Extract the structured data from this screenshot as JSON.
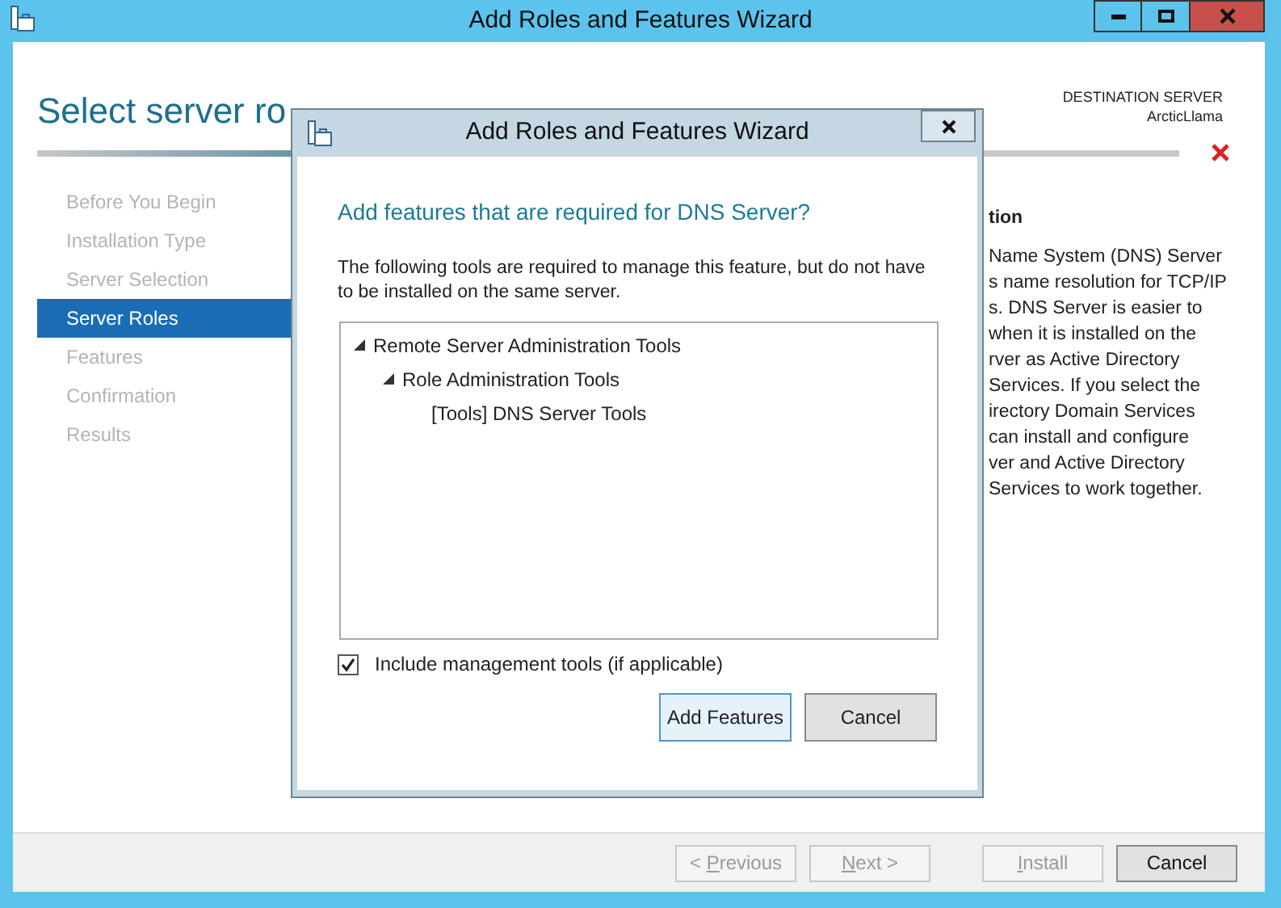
{
  "window": {
    "title": "Add Roles and Features Wizard"
  },
  "page": {
    "title": "Select server ro",
    "destination_label": "DESTINATION SERVER",
    "destination_server": "ArcticLlama"
  },
  "steps": [
    {
      "label": "Before You Begin",
      "selected": false
    },
    {
      "label": "Installation Type",
      "selected": false
    },
    {
      "label": "Server Selection",
      "selected": false
    },
    {
      "label": "Server Roles",
      "selected": true
    },
    {
      "label": "Features",
      "selected": false
    },
    {
      "label": "Confirmation",
      "selected": false
    },
    {
      "label": "Results",
      "selected": false
    }
  ],
  "description": {
    "heading": "tion",
    "lines": [
      "Name System (DNS) Server",
      "s name resolution for TCP/IP",
      "s. DNS Server is easier to",
      "when it is installed on the",
      "rver as Active Directory",
      "Services. If you select the",
      "irectory Domain Services",
      "can install and configure",
      "ver and Active Directory",
      "Services to work together."
    ]
  },
  "dialog": {
    "title": "Add Roles and Features Wizard",
    "heading": "Add features that are required for DNS Server?",
    "text": "The following tools are required to manage this feature, but do not have to be installed on the same server.",
    "tree": [
      {
        "label": "Remote Server Administration Tools",
        "expanded": true,
        "children": [
          {
            "label": "Role Administration Tools",
            "expanded": true,
            "children": [
              {
                "label": "[Tools] DNS Server Tools"
              }
            ]
          }
        ]
      }
    ],
    "include_tools": {
      "label": "Include management tools (if applicable)",
      "checked": true
    },
    "buttons": [
      {
        "label": "Add Features",
        "selected": true
      },
      {
        "label": "Cancel",
        "selected": false
      }
    ]
  },
  "footer_buttons": [
    {
      "before": "< ",
      "key": "P",
      "after": "revious",
      "disabled": true
    },
    {
      "key": "N",
      "after": "ext >",
      "disabled": true
    },
    {
      "key": "I",
      "after": "nstall",
      "disabled": true
    },
    {
      "before": "Cancel",
      "disabled": false
    }
  ]
}
